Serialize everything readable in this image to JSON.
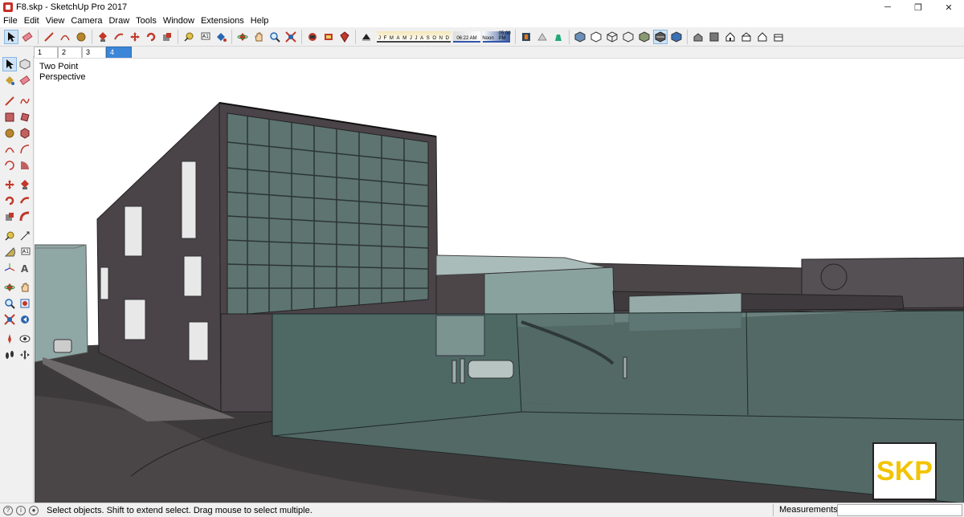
{
  "window": {
    "title": "F8.skp - SketchUp Pro 2017",
    "minimize": "─",
    "maximize": "❐",
    "close": "✕"
  },
  "menu": [
    "File",
    "Edit",
    "View",
    "Camera",
    "Draw",
    "Tools",
    "Window",
    "Extensions",
    "Help"
  ],
  "shadow": {
    "months": [
      "J",
      "F",
      "M",
      "A",
      "M",
      "J",
      "J",
      "A",
      "S",
      "O",
      "N",
      "D"
    ],
    "time_left": "06:22 AM",
    "time_mid": "Noon",
    "time_right": "05:00 PM"
  },
  "scenes": [
    "1",
    "2",
    "3",
    "4"
  ],
  "active_scene": "4",
  "view": {
    "label_line1": "Two Point",
    "label_line2": "Perspective"
  },
  "watermark": "SKP",
  "status": {
    "message": "Select objects. Shift to extend select. Drag mouse to select multiple.",
    "measurements_label": "Measurements",
    "measurements_value": ""
  },
  "colors": {
    "accent": "#3b86d8",
    "logo_yellow": "#f3c300",
    "building": "#4a4347",
    "glass": "#5d7470"
  }
}
